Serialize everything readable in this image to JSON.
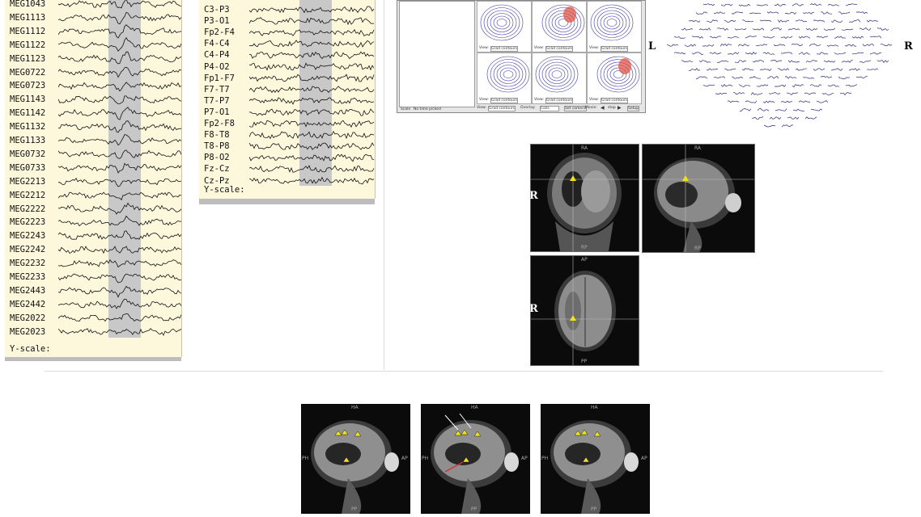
{
  "meg_panel": {
    "channels": [
      "MEG1043",
      "MEG1113",
      "MEG1112",
      "MEG1122",
      "MEG1123",
      "MEG0722",
      "MEG0723",
      "MEG1143",
      "MEG1142",
      "MEG1132",
      "MEG1133",
      "MEG0732",
      "MEG0733",
      "MEG2213",
      "MEG2212",
      "MEG2222",
      "MEG2223",
      "MEG2243",
      "MEG2242",
      "MEG2232",
      "MEG2233",
      "MEG2443",
      "MEG2442",
      "MEG2022",
      "MEG2023"
    ],
    "yscale_label": "Y-scale:"
  },
  "eeg_panel": {
    "channels": [
      "C3-P3",
      "P3-O1",
      "Fp2-F4",
      "F4-C4",
      "C4-P4",
      "P4-O2",
      "Fp1-F7",
      "F7-T7",
      "T7-P7",
      "P7-O1",
      "Fp2-F8",
      "F8-T8",
      "T8-P8",
      "P8-O2",
      "Fz-Cz",
      "Cz-Pz"
    ],
    "yscale_label": "Y-scale:"
  },
  "topo_panel": {
    "view_labels": [
      "View:",
      "View:",
      "View:",
      "View:",
      "View:",
      "View:"
    ],
    "view_values": [
      "Grad contours",
      "Grad contours",
      "Grad contours",
      "Grad contours",
      "Grad contours",
      "Grad contours"
    ],
    "status_left": "Scale",
    "status_mid": "No time picked",
    "bottom_bar": [
      "View:",
      "Grad contours",
      "Overlay:",
      "Coils",
      "Set camera",
      "Movie:",
      "stop",
      "Setup"
    ]
  },
  "sensor_layout": {
    "left_label": "L",
    "right_label": "R"
  },
  "mri_triplanar": {
    "r_labels": [
      "R",
      "R",
      "R"
    ],
    "top_labels": [
      "RA",
      "RA",
      "AP"
    ],
    "bottom_labels": [
      "RP",
      "RP",
      "PP"
    ]
  },
  "mri_sagittal_row": {
    "top_labels": [
      "HA",
      "HA",
      "HA"
    ],
    "left_labels": [
      "PH",
      "PH",
      "PH"
    ],
    "right_labels": [
      "AP",
      "AP",
      "AP"
    ],
    "bottom_labels": [
      "PP",
      "PP",
      "PP"
    ]
  },
  "colors": {
    "trace_bg": "#fdf8dc",
    "highlight": "#c8c8c8",
    "marker": "#f2e01a",
    "arrow_red": "#d23030"
  }
}
